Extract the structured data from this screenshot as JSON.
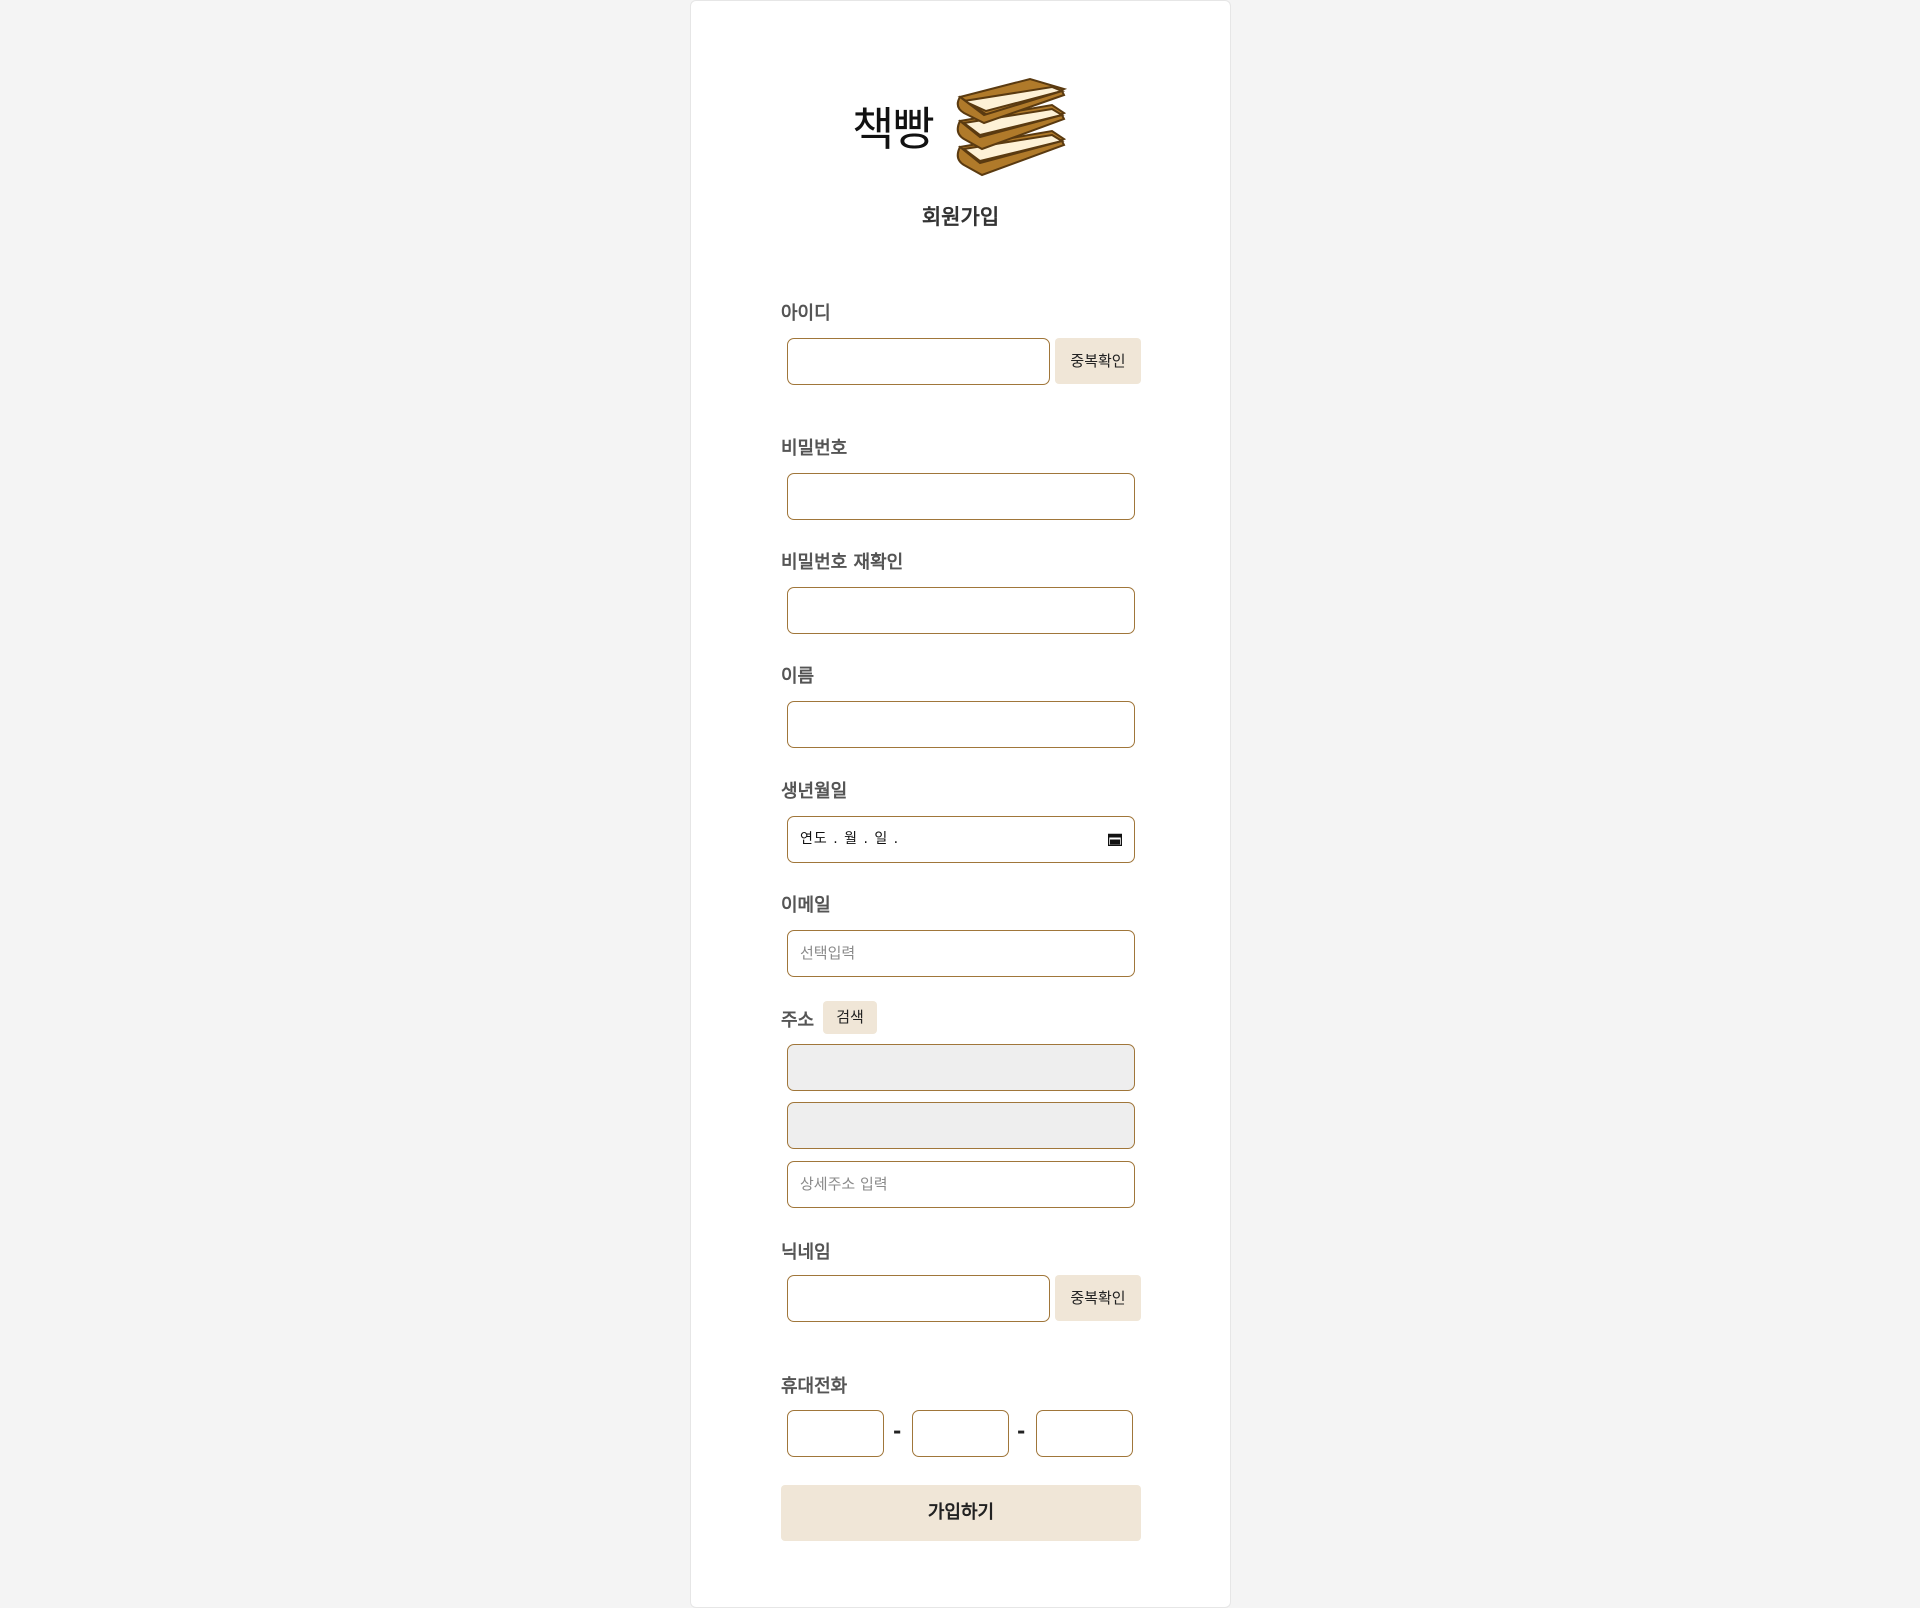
{
  "logo": {
    "text": "책빵",
    "icon": "book-stack-icon"
  },
  "title": "회원가입",
  "fields": {
    "id": {
      "label": "아이디",
      "button": "중복확인",
      "value": ""
    },
    "password": {
      "label": "비밀번호",
      "value": ""
    },
    "password_confirm": {
      "label": "비밀번호 재확인",
      "value": ""
    },
    "name": {
      "label": "이름",
      "value": ""
    },
    "birth": {
      "label": "생년월일",
      "placeholder": "연도 .  월 .  일 .",
      "icon": "calendar-icon"
    },
    "email": {
      "label": "이메일",
      "placeholder": "선택입력"
    },
    "address": {
      "label": "주소",
      "search_button": "검색",
      "detail_placeholder": "상세주소 입력"
    },
    "nickname": {
      "label": "닉네임",
      "button": "중복확인",
      "value": ""
    },
    "phone": {
      "label": "휴대전화",
      "separator": "-"
    }
  },
  "submit": "가입하기",
  "colors": {
    "background": "#f4f4f4",
    "card": "#ffffff",
    "input_border": "#a0763a",
    "button_bg": "#f0e6d7",
    "disabled_bg": "#eeeeee",
    "book_brown": "#b07a2a",
    "book_pages": "#fdf1d6"
  }
}
